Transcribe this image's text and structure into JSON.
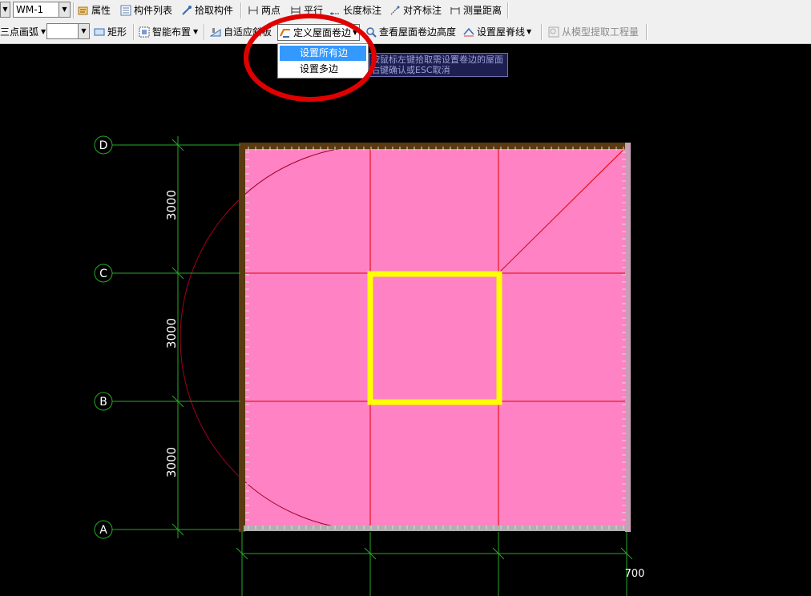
{
  "toolbar1": {
    "component_combo": "WM-1",
    "properties": "属性",
    "component_list": "构件列表",
    "pick_component": "拾取构件",
    "two_points": "两点",
    "parallel": "平行",
    "length_dim": "长度标注",
    "align_dim": "对齐标注",
    "measure_distance": "测量距离"
  },
  "toolbar2": {
    "draw_mode_combo": "三点画弧",
    "rectangle": "矩形",
    "smart_layout": "智能布置",
    "adaptive_slope": "自适应斜板",
    "define_roof_edge": "定义屋面卷边",
    "view_roof_edge_height": "查看屋面卷边高度",
    "set_roof_ridge": "设置屋脊线",
    "extract_quantity": "从模型提取工程量"
  },
  "dropdown": {
    "items": [
      "设置所有边",
      "设置多边"
    ],
    "selected_index": 0
  },
  "tooltip": {
    "line1": "按鼠标左键拾取需设置卷边的屋面",
    "line2": "右键确认或ESC取消"
  },
  "drawing": {
    "axis_labels": [
      "D",
      "C",
      "B",
      "A"
    ],
    "dimensions": [
      "3000",
      "3000",
      "3000"
    ],
    "corner_label": "700",
    "colors": {
      "roof_fill": "#ff82c4",
      "grid_line": "#e00000",
      "axis_line": "#27a827",
      "edge_border": "#5a3a10",
      "opening": "#ffff00",
      "highlight_circle": "#e00000",
      "background": "#000000"
    }
  }
}
